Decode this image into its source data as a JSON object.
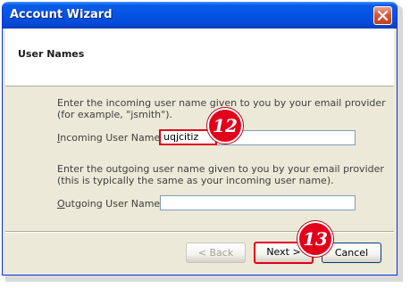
{
  "window": {
    "title": "Account Wizard"
  },
  "header": {
    "title": "User Names"
  },
  "incoming": {
    "description_line1": "Enter the incoming user name given to you by your email provider",
    "description_line2": "(for example, \"jsmith\").",
    "label_prefix": "I",
    "label_rest": "ncoming User Name:",
    "value": "uqjcitiz",
    "step_badge": "12"
  },
  "outgoing": {
    "description_line1": "Enter the outgoing user name given to you by your email provider",
    "description_line2": "(this is typically the same as your incoming user name).",
    "label_prefix": "O",
    "label_rest": "utgoing User Name:",
    "value": ""
  },
  "buttons": {
    "back": "< Back",
    "next": "Next >",
    "cancel": "Cancel",
    "next_step_badge": "13"
  },
  "colors": {
    "highlight": "#e2001a",
    "title_bar": "#0454e3"
  }
}
